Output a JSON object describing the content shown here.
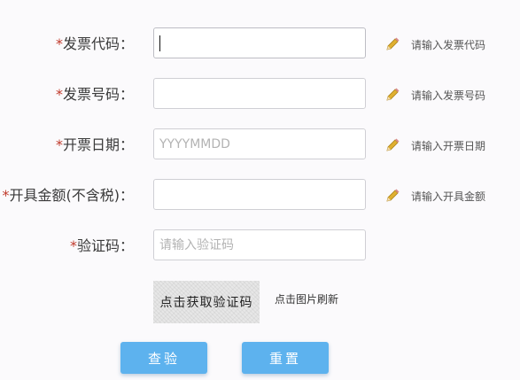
{
  "form": {
    "required_mark": "*",
    "fields": [
      {
        "label": "发票代码：",
        "value": "",
        "placeholder": "",
        "hint": "请输入发票代码"
      },
      {
        "label": "发票号码：",
        "value": "",
        "placeholder": "",
        "hint": "请输入发票号码"
      },
      {
        "label": "开票日期：",
        "value": "",
        "placeholder": "YYYYMMDD",
        "hint": "请输入开票日期"
      },
      {
        "label": "开具金额(不含税)：",
        "value": "",
        "placeholder": "",
        "hint": "请输入开具金额"
      },
      {
        "label": "验证码：",
        "value": "",
        "placeholder": "请输入验证码"
      }
    ],
    "hint_icon": "pencil-icon",
    "captcha": {
      "image_text": "点击获取验证码",
      "refresh_text": "点击图片刷新"
    },
    "buttons": {
      "check": "查验",
      "reset": "重置"
    },
    "colors": {
      "button": "#5db2ee",
      "required": "#c0392b",
      "pencil": "#e0b030"
    }
  }
}
